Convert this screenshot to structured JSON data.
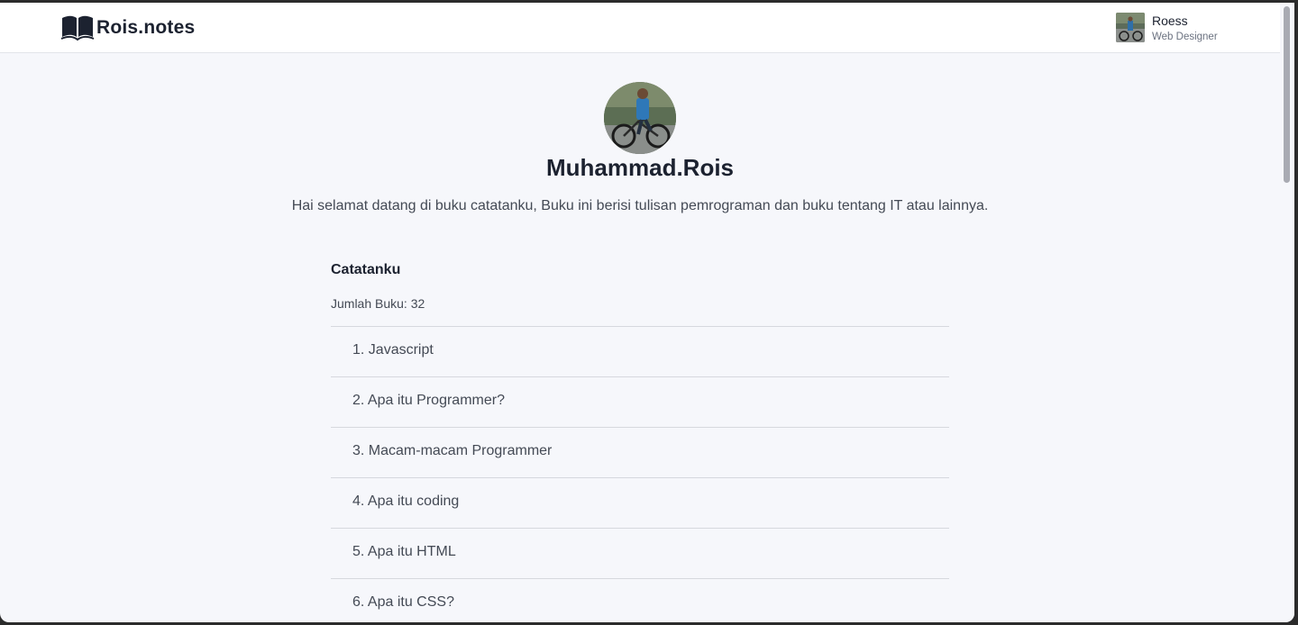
{
  "navbar": {
    "brand": "Rois.notes",
    "brand_icon": "open-book-icon",
    "user": {
      "name": "Roess",
      "role": "Web Designer"
    }
  },
  "profile": {
    "name": "Muhammad.Rois",
    "description": "Hai selamat datang di buku catatanku, Buku ini berisi tulisan pemrograman dan buku tentang IT atau lainnya."
  },
  "notes": {
    "title": "Catatanku",
    "count_text": "Jumlah Buku: 32",
    "items": [
      "1. Javascript",
      "2. Apa itu Programmer?",
      "3. Macam-macam Programmer",
      "4. Apa itu coding",
      "5. Apa itu HTML",
      "6. Apa itu CSS?"
    ]
  },
  "colors": {
    "background": "#f6f7fb",
    "navbar": "#ffffff",
    "text_dark": "#1c2230",
    "text_body": "#444a55",
    "divider": "#d6d8de"
  }
}
